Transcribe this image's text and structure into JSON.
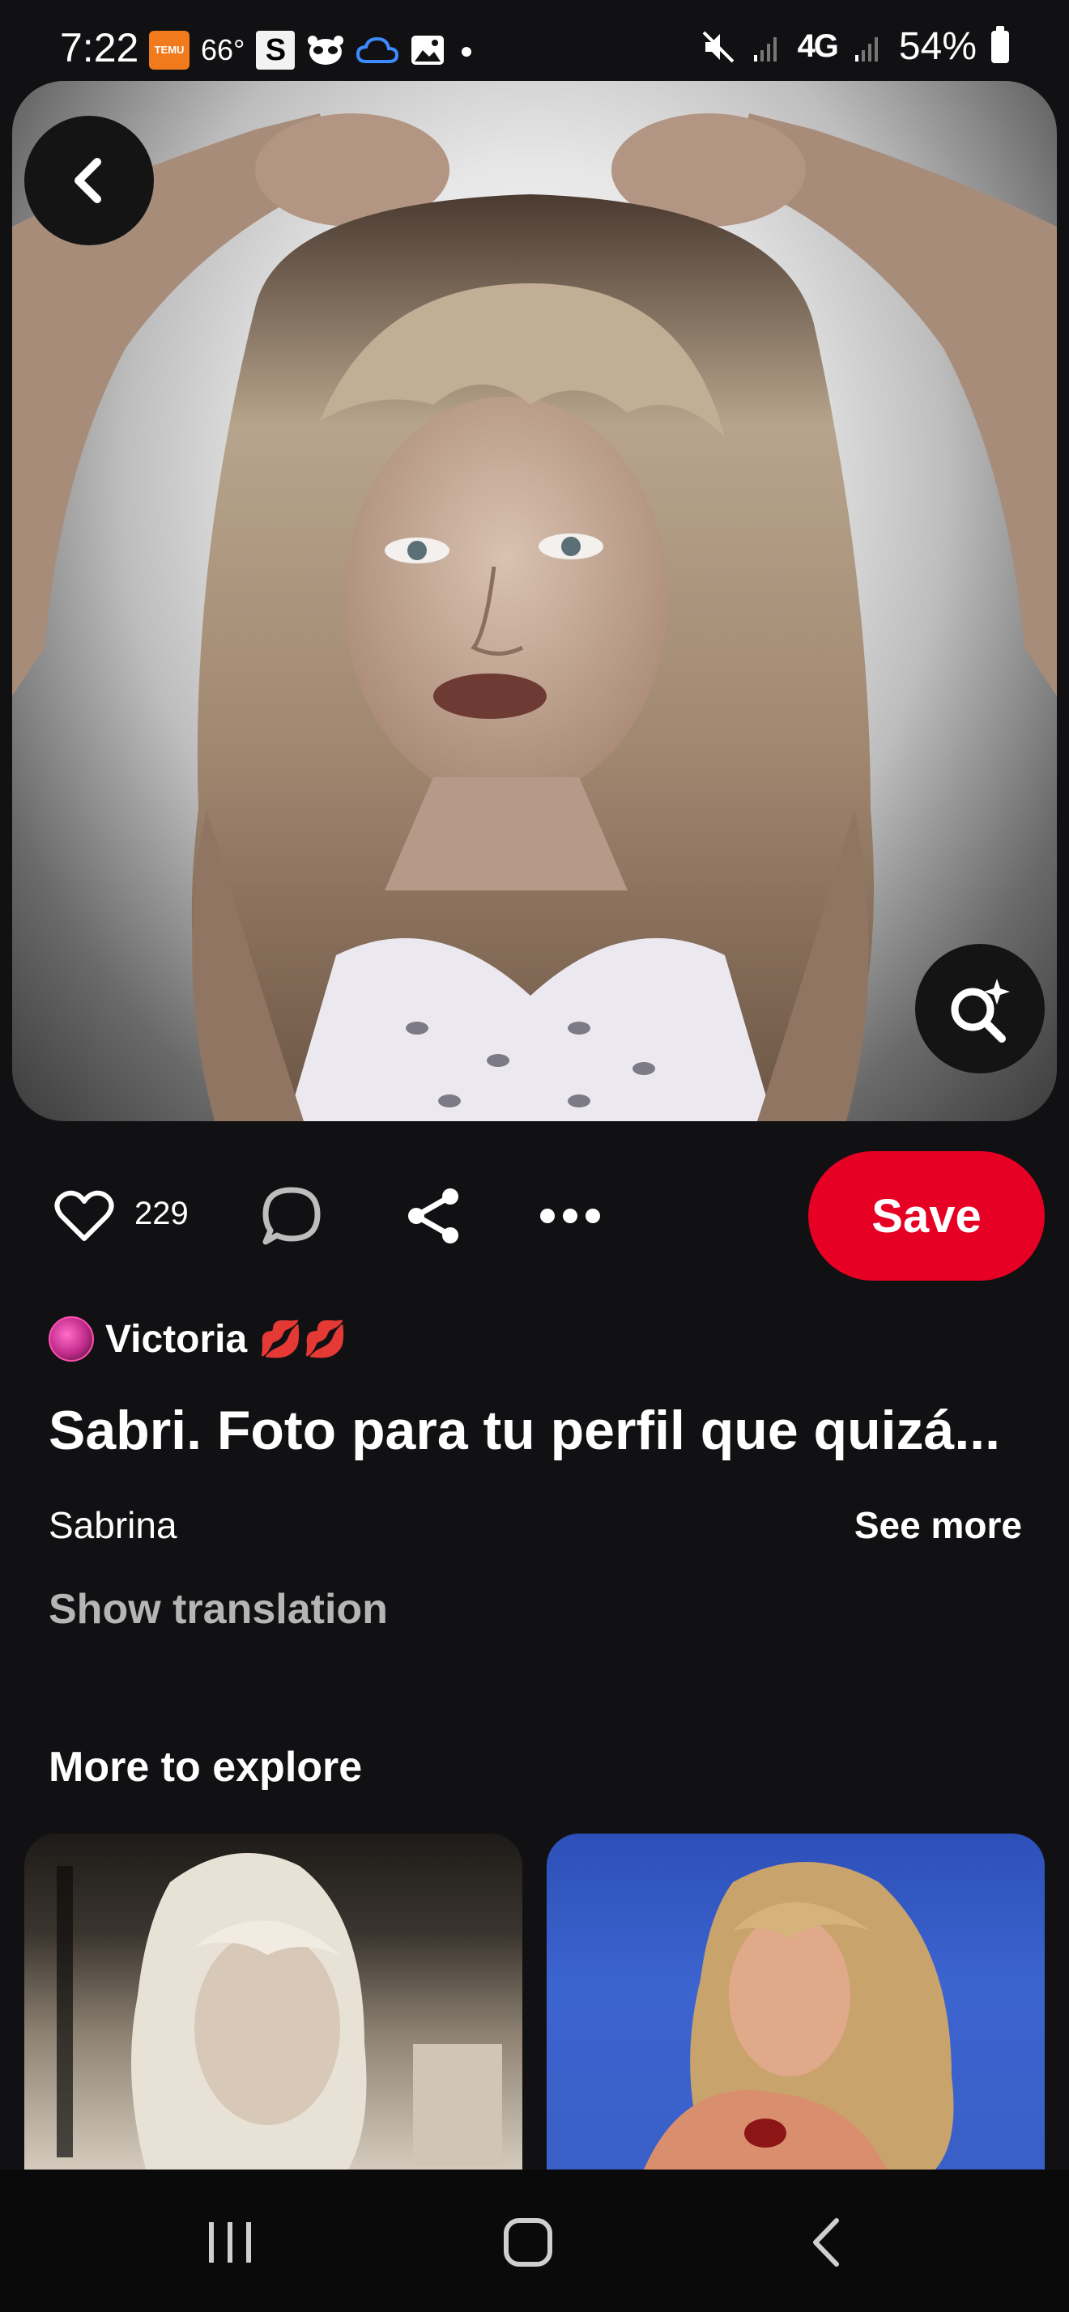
{
  "status_bar": {
    "time": "7:22",
    "temu_label": "TEMU",
    "temperature": "66°",
    "s_app": "S",
    "network": "4G",
    "battery": "54%"
  },
  "pin": {
    "like_count": "229",
    "save_label": "Save",
    "author_name": "Victoria",
    "author_emoji": "💋💋",
    "title": "Sabri. Foto para tu perfil que quizá...",
    "description": "Sabrina",
    "see_more_label": "See more",
    "translation_label": "Show translation"
  },
  "explore": {
    "title": "More to explore"
  },
  "colors": {
    "background": "#111113",
    "save_red": "#e60023",
    "muted_text": "#b5b5b5"
  },
  "icons": {
    "back": "chevron-left-icon",
    "visual_search": "lens-search-icon",
    "like": "heart-icon",
    "comment": "comment-icon",
    "share": "share-icon",
    "more": "more-icon"
  }
}
